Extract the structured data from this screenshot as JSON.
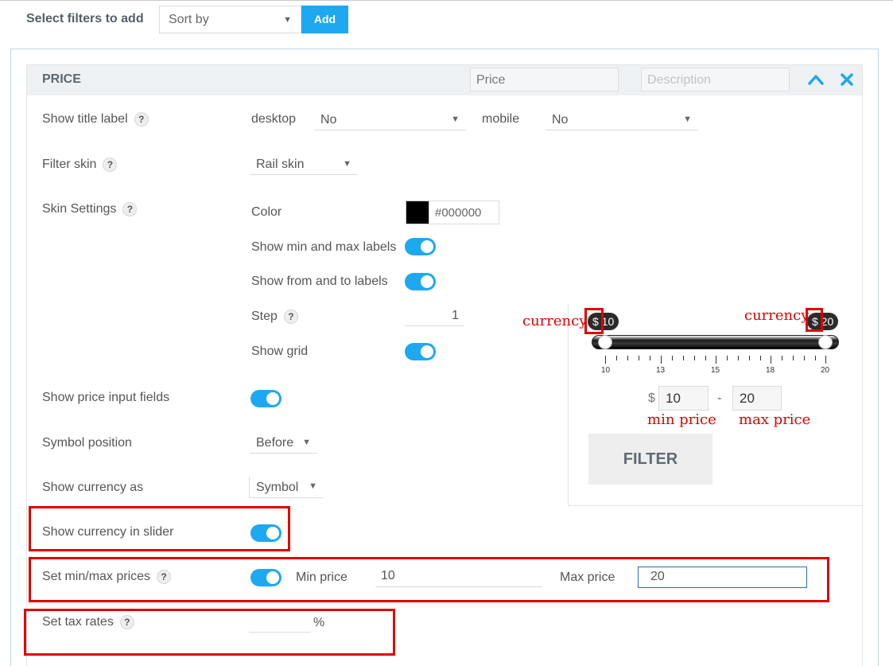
{
  "topbar": {
    "label": "Select filters to add",
    "sort_value": "Sort by",
    "add_label": "Add"
  },
  "panel": {
    "title": "PRICE",
    "title_input_value": "Price",
    "description_placeholder": "Description"
  },
  "rows": {
    "show_title_label": {
      "label": "Show title label",
      "desktop_label": "desktop",
      "desktop_value": "No",
      "mobile_label": "mobile",
      "mobile_value": "No"
    },
    "filter_skin": {
      "label": "Filter skin",
      "value": "Rail skin"
    },
    "skin_settings": {
      "label": "Skin Settings",
      "color_label": "Color",
      "color_value": "#000000",
      "show_min_max_label": "Show min and max labels",
      "show_from_to_label": "Show from and to labels",
      "step_label": "Step",
      "step_value": "1",
      "show_grid_label": "Show grid"
    },
    "show_price_inputs": {
      "label": "Show price input fields"
    },
    "symbol_position": {
      "label": "Symbol position",
      "value": "Before"
    },
    "show_currency_as": {
      "label": "Show currency as",
      "value": "Symbol"
    },
    "show_currency_in_slider": {
      "label": "Show currency in slider"
    },
    "set_min_max": {
      "label": "Set min/max prices",
      "min_label": "Min price",
      "min_value": "10",
      "max_label": "Max price",
      "max_value": "20"
    },
    "set_tax": {
      "label": "Set tax rates",
      "unit": "%"
    }
  },
  "help_glyph": "?",
  "preview": {
    "from_tag": "$ 10",
    "to_tag": "$ 20",
    "tick_labels": [
      "10",
      "13",
      "15",
      "18",
      "20"
    ],
    "currency_symbol": "$",
    "min_input": "10",
    "dash": "-",
    "max_input": "20",
    "filter_label": "FILTER"
  },
  "annotations": {
    "currency_left": "currency",
    "currency_right": "currency",
    "min_price": "min price",
    "max_price": "max price"
  },
  "colors": {
    "accent": "#1ea8f0",
    "annotation": "#e00000",
    "swatch": "#000000"
  },
  "icons": [
    "chevron-up-icon",
    "close-icon",
    "caret-down-icon",
    "help-icon"
  ]
}
